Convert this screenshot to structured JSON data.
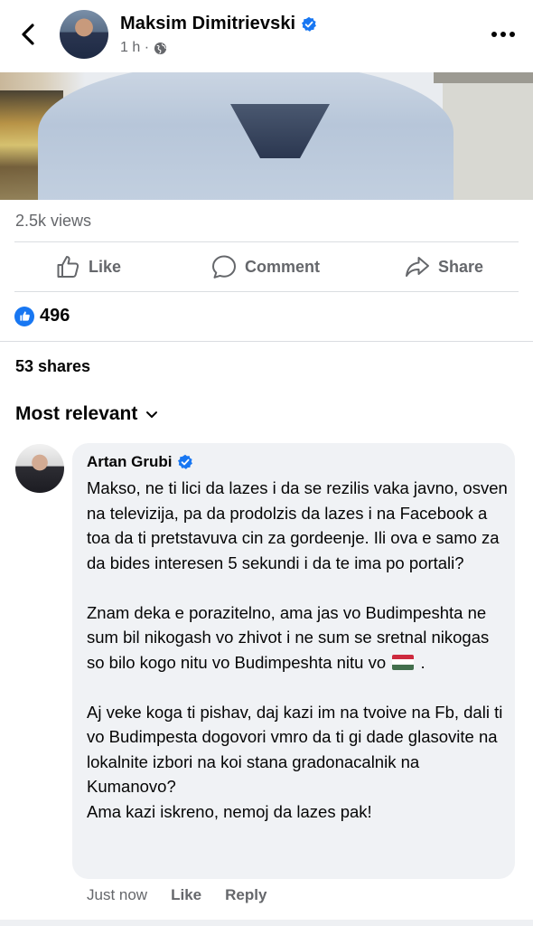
{
  "post": {
    "author": "Maksim Dimitrievski",
    "time": "1 h ·",
    "views": "2.5k views",
    "actions": {
      "like": "Like",
      "comment": "Comment",
      "share": "Share"
    },
    "reaction_count": "496",
    "shares": "53 shares"
  },
  "comments_sort": "Most relevant",
  "comment": {
    "author": "Artan Grubi",
    "paragraphs": [
      "Makso, ne ti lici da lazes i da se rezilis vaka javno, osven na televizija, pa da prodolzis da lazes i na Facebook a toa da ti pretstavuva cin za gordeenje. Ili ova e samo za da bides interesen 5 sekundi i da te ima po portali?",
      "Znam deka e porazitelno, ama jas vo Budimpeshta ne sum bil nikogash vo zhivot i ne sum se sretnal nikogas so bilo kogo nitu vo Budimpeshta nitu vo",
      "."
    ],
    "paragraph3_line1": "Aj veke koga ti pishav, daj kazi im na tvoive na Fb, dali ti vo Budimpesta dogovori vmro da ti gi dade glasovite na lokalnite izbori na koi stana gradonacalnik na Kumanovo?",
    "paragraph3_line2": "Ama kazi iskreno, nemoj da lazes pak!",
    "time": "Just now",
    "like": "Like",
    "reply": "Reply"
  },
  "icons": [
    "back-arrow-icon",
    "verified-badge-icon",
    "globe-icon",
    "more-icon",
    "thumbs-up-icon",
    "comment-icon",
    "share-arrow-icon",
    "chevron-down-icon",
    "hungary-flag-icon"
  ],
  "colors": {
    "accent": "#1877f2",
    "muted": "#65676b",
    "bubble": "#f0f2f5"
  }
}
